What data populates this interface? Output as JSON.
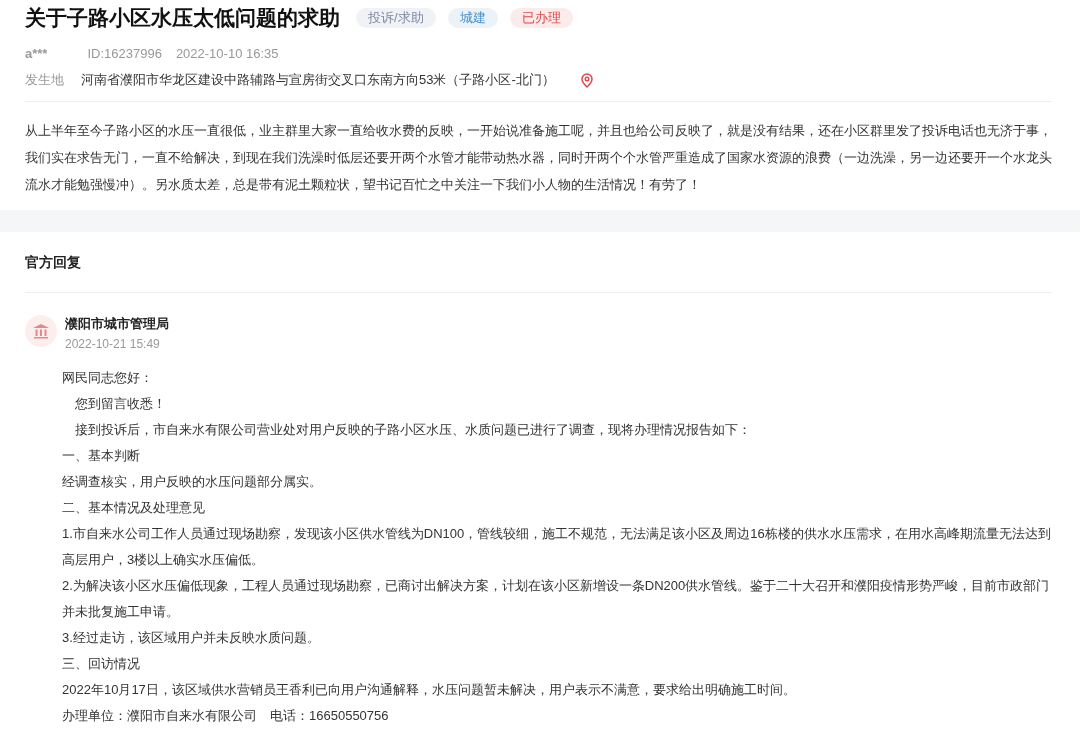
{
  "title": "关于子路小区水压太低问题的求助",
  "tags": [
    {
      "label": "投诉/求助",
      "color": "#7f8aa3"
    },
    {
      "label": "城建",
      "color": "#4a8fc9"
    },
    {
      "label": "已办理",
      "color": "#e0474c"
    }
  ],
  "author": "a***",
  "id": "ID:16237996",
  "time": "2022-10-10 16:35",
  "location": {
    "label": "发生地",
    "value": "河南省濮阳市华龙区建设中路辅路与宣房街交叉口东南方向53米（子路小区-北门）"
  },
  "message": "从上半年至今子路小区的水压一直很低，业主群里大家一直给收水费的反映，一开始说准备施工呢，并且也给公司反映了，就是没有结果，还在小区群里发了投诉电话也无济于事，我们实在求告无门，一直不给解决，到现在我们洗澡时低层还要开两个水管才能带动热水器，同时开两个个水管严重造成了国家水资源的浪费（一边洗澡，另一边还要开一个水龙头流水才能勉强慢冲）。另水质太差，总是带有泥土颗粒状，望书记百忙之中关注一下我们小人物的生活情况！有劳了！",
  "reply": {
    "heading": "官方回复",
    "department": "濮阳市城市管理局",
    "time": "2022-10-21 15:49",
    "lines": [
      {
        "text": "网民同志您好：",
        "indented": false
      },
      {
        "text": "您到留言收悉！",
        "indented": true
      },
      {
        "text": "接到投诉后，市自来水有限公司营业处对用户反映的子路小区水压、水质问题已进行了调查，现将办理情况报告如下：",
        "indented": true
      },
      {
        "text": "一、基本判断",
        "indented": false
      },
      {
        "text": "经调查核实，用户反映的水压问题部分属实。",
        "indented": false
      },
      {
        "text": "二、基本情况及处理意见",
        "indented": false
      },
      {
        "text": "1.市自来水公司工作人员通过现场勘察，发现该小区供水管线为DN100，管线较细，施工不规范，无法满足该小区及周边16栋楼的供水水压需求，在用水高峰期流量无法达到高层用户，3楼以上确实水压偏低。",
        "indented": false
      },
      {
        "text": "2.为解决该小区水压偏低现象，工程人员通过现场勘察，已商讨出解决方案，计划在该小区新增设一条DN200供水管线。鉴于二十大召开和濮阳疫情形势严峻，目前市政部门并未批复施工申请。",
        "indented": false
      },
      {
        "text": "3.经过走访，该区域用户并未反映水质问题。",
        "indented": false
      },
      {
        "text": "三、回访情况",
        "indented": false
      },
      {
        "text": "2022年10月17日，该区域供水营销员王香利已向用户沟通解释，水压问题暂未解决，用户表示不满意，要求给出明确施工时间。",
        "indented": false
      },
      {
        "text": "办理单位：濮阳市自来水有限公司　电话：16650550756",
        "indented": false
      }
    ]
  }
}
